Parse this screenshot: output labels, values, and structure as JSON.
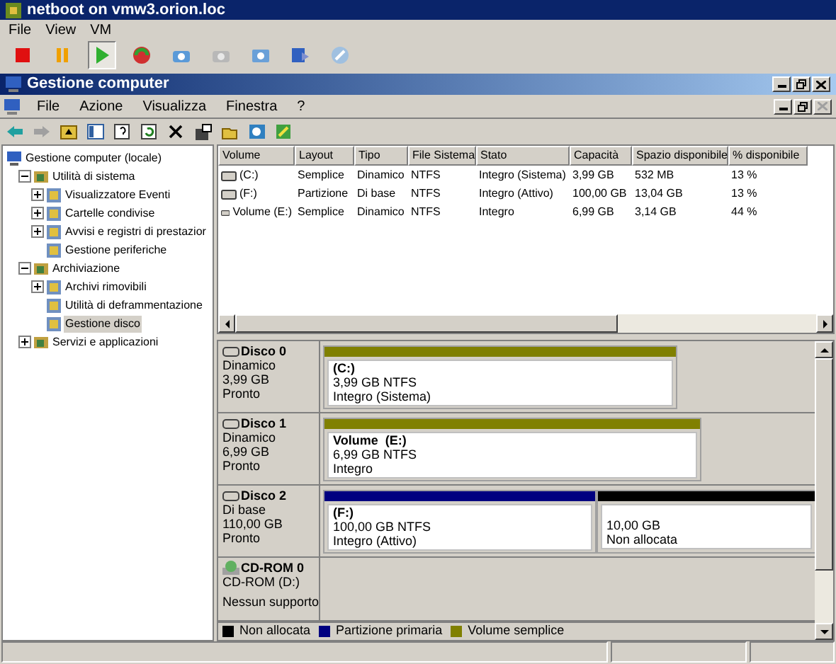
{
  "vm_window": {
    "title": "netboot on vmw3.orion.loc",
    "menu": [
      "File",
      "View",
      "VM"
    ],
    "toolbar": [
      {
        "kind": "stop",
        "selected": false
      },
      {
        "kind": "pause",
        "selected": false
      },
      {
        "kind": "play",
        "selected": true
      },
      {
        "kind": "reset",
        "selected": false
      },
      {
        "kind": "snapshot",
        "selected": false
      },
      {
        "kind": "revert",
        "selected": false
      },
      {
        "kind": "manager",
        "selected": false
      },
      {
        "kind": "send",
        "selected": false
      },
      {
        "kind": "tools",
        "selected": false
      }
    ]
  },
  "app_window": {
    "title": "Gestione computer",
    "menu": [
      "File",
      "Azione",
      "Visualizza",
      "Finestra",
      "?"
    ],
    "toolbar": [
      {
        "kind": "back"
      },
      {
        "kind": "forward"
      },
      {
        "kind": "up"
      },
      {
        "kind": "view"
      },
      {
        "kind": "help"
      },
      {
        "kind": "refresh"
      },
      {
        "kind": "delete"
      },
      {
        "kind": "properties"
      },
      {
        "kind": "open"
      },
      {
        "kind": "find"
      },
      {
        "kind": "wizard"
      }
    ]
  },
  "tree": [
    {
      "label": "Gestione computer (locale)",
      "selected": false,
      "children": [
        {
          "label": "Utilità di sistema",
          "expanded": true,
          "selected": false,
          "children": [
            {
              "label": "Visualizzatore Eventi",
              "expanded": false,
              "selected": false
            },
            {
              "label": "Cartelle condivise",
              "expanded": false,
              "selected": false
            },
            {
              "label": "Avvisi e registri di prestazior",
              "expanded": false,
              "selected": false
            },
            {
              "label": "Gestione periferiche",
              "selected": false
            }
          ]
        },
        {
          "label": "Archiviazione",
          "expanded": true,
          "selected": false,
          "children": [
            {
              "label": "Archivi rimovibili",
              "expanded": false,
              "selected": false
            },
            {
              "label": "Utilità di deframmentazione",
              "selected": false
            },
            {
              "label": "Gestione disco",
              "selected": true
            }
          ]
        },
        {
          "label": "Servizi e applicazioni",
          "expanded": false,
          "selected": false
        }
      ]
    }
  ],
  "table": {
    "columns": [
      "Volume",
      "Layout",
      "Tipo",
      "File Sistema",
      "Stato",
      "Capacità",
      "Spazio disponibile",
      "% disponibile"
    ],
    "rows": [
      [
        "(C:)",
        "Semplice",
        "Dinamico",
        "NTFS",
        "Integro (Sistema)",
        "3,99 GB",
        "532 MB",
        "13 %"
      ],
      [
        "(F:)",
        "Partizione",
        "Di base",
        "NTFS",
        "Integro (Attivo)",
        "100,00 GB",
        "13,04 GB",
        "13 %"
      ],
      [
        "Volume (E:)",
        "Semplice",
        "Dinamico",
        "NTFS",
        "Integro",
        "6,99 GB",
        "3,14 GB",
        "44 %"
      ]
    ]
  },
  "disks": [
    {
      "name": "Disco 0",
      "kind": "disk",
      "info": [
        "Dinamico",
        "3,99 GB",
        "Pronto"
      ],
      "partitions": [
        {
          "label": "(C:)",
          "color": "#808000",
          "lines": [
            "3,99 GB NTFS",
            "Integro (Sistema)"
          ]
        }
      ]
    },
    {
      "name": "Disco 1",
      "kind": "disk",
      "info": [
        "Dinamico",
        "6,99 GB",
        "Pronto"
      ],
      "partitions": [
        {
          "label": "Volume  (E:)",
          "color": "#808000",
          "lines": [
            "6,99 GB NTFS",
            "Integro"
          ]
        }
      ]
    },
    {
      "name": "Disco 2",
      "kind": "disk",
      "info": [
        "Di base",
        "110,00 GB",
        "Pronto"
      ],
      "partitions": [
        {
          "label": "(F:)",
          "color": "#000080",
          "lines": [
            "100,00 GB NTFS",
            "Integro (Attivo)"
          ]
        },
        {
          "color": "#000000",
          "lines": [
            "10,00 GB",
            "Non allocata"
          ]
        }
      ]
    },
    {
      "name": "CD-ROM 0",
      "kind": "cdrom",
      "info": [
        "CD-ROM (D:)",
        "Nessun supporto"
      ]
    }
  ],
  "legend": [
    {
      "label": "Non allocata",
      "color": "#000000"
    },
    {
      "label": "Partizione primaria",
      "color": "#000080"
    },
    {
      "label": "Volume semplice",
      "color": "#808000"
    }
  ]
}
